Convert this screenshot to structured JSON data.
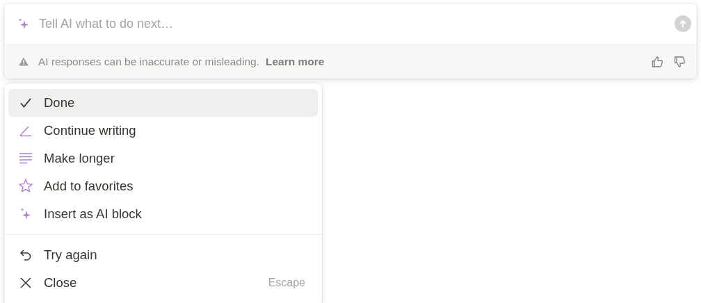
{
  "prompt": {
    "placeholder": "Tell AI what to do next…"
  },
  "notice": {
    "text": "AI responses can be inaccurate or misleading.",
    "link": "Learn more"
  },
  "menu": {
    "groups": [
      {
        "items": [
          {
            "kind": "check",
            "label": "Done",
            "selected": true
          },
          {
            "kind": "pen",
            "label": "Continue writing",
            "selected": false
          },
          {
            "kind": "lines",
            "label": "Make longer",
            "selected": false
          },
          {
            "kind": "star",
            "label": "Add to favorites",
            "selected": false
          },
          {
            "kind": "sparkle",
            "label": "Insert as AI block",
            "selected": false
          }
        ]
      },
      {
        "items": [
          {
            "kind": "undo",
            "label": "Try again",
            "selected": false
          },
          {
            "kind": "close",
            "label": "Close",
            "selected": false,
            "shortcut": "Escape"
          }
        ]
      }
    ]
  }
}
